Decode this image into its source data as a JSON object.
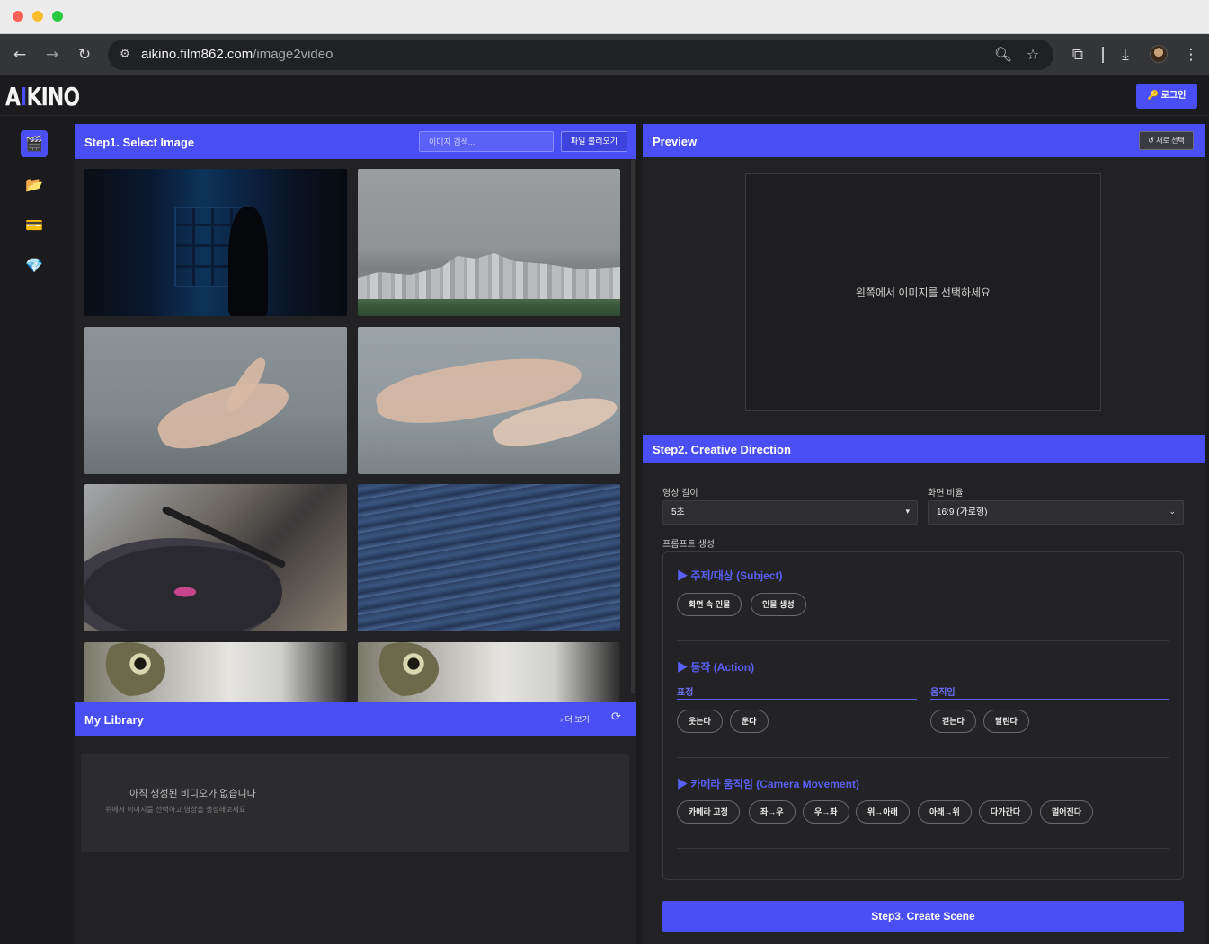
{
  "browser": {
    "url_host": "aikino.film862.com",
    "url_path": "/image2video",
    "icons": [
      "back-icon",
      "forward-icon",
      "reload-icon",
      "site-settings-icon",
      "zoom-icon",
      "bookmark-star-icon",
      "extensions-icon",
      "download-icon",
      "profile-avatar",
      "more-menu-icon"
    ]
  },
  "header": {
    "logo_prefix": "A",
    "logo_mark": "I",
    "logo_suffix": "KINO",
    "login_label": "🔑 로그인"
  },
  "sidebar": {
    "items": [
      {
        "name": "video",
        "glyph": "🎬",
        "active": true
      },
      {
        "name": "folder",
        "glyph": "📂",
        "active": false
      },
      {
        "name": "card",
        "glyph": "💳",
        "active": false
      },
      {
        "name": "gem",
        "glyph": "💎",
        "active": false
      }
    ]
  },
  "step1": {
    "title": "Step1. Select Image",
    "search_placeholder": "이미지 검색...",
    "load_button": "파일 불러오기"
  },
  "library": {
    "title": "My Library",
    "more_label": "› 더 보기",
    "refresh_glyph": "⟳",
    "empty_title": "아직 생성된 비디오가 없습니다",
    "empty_sub": "위에서 이미지를 선택하고 영상을 생성해보세요"
  },
  "preview": {
    "title": "Preview",
    "new_select": "↺ 새로 선택",
    "placeholder": "왼쪽에서 이미지를 선택하세요"
  },
  "step2": {
    "title": "Step2. Creative Direction",
    "duration_label": "영상 길이",
    "duration_value": "5초",
    "ratio_label": "화면 비율",
    "ratio_value": "16:9 (가로형)",
    "prompt_label": "프롬프트 생성",
    "subject": {
      "title": "▶ 주제/대상 (Subject)",
      "chips": [
        "화면 속 인물",
        "인물 생성"
      ]
    },
    "action": {
      "title": "▶ 동작 (Action)",
      "expression_label": "표정",
      "expression_chips": [
        "웃는다",
        "운다"
      ],
      "movement_label": "움직임",
      "movement_chips": [
        "걷는다",
        "달린다"
      ]
    },
    "camera": {
      "title": "▶ 카메라 움직임 (Camera Movement)",
      "chips": [
        "카메라 고정",
        "좌→우",
        "우→좌",
        "위→아래",
        "아래→위",
        "다가간다",
        "멀어진다"
      ]
    }
  },
  "step3": {
    "label": "Step3. Create Scene"
  },
  "colors": {
    "accent": "#4a4ff5",
    "background": "#1b1b1d",
    "panel": "#222224"
  }
}
